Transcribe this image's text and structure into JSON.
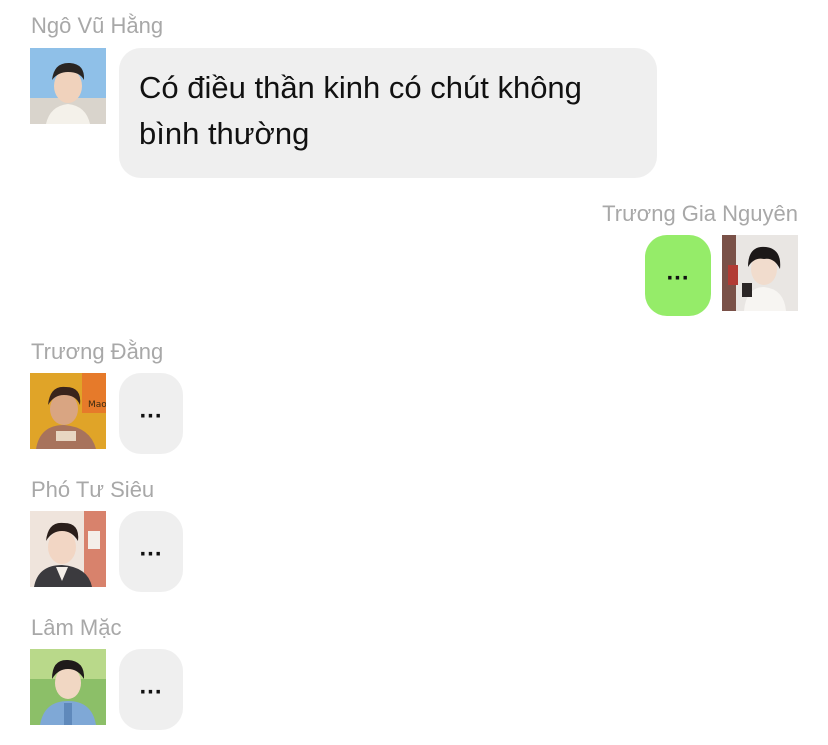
{
  "messages": [
    {
      "sender": "Ngô Vũ Hằng",
      "text": "Có điều thần kinh có chút không bình thường",
      "side": "left",
      "avatar": "avatar-ngo-vu-hang"
    },
    {
      "sender": "Trương Gia Nguyên",
      "text": "...",
      "side": "right",
      "avatar": "avatar-truong-gia-nguyen"
    },
    {
      "sender": "Trương Đằng",
      "text": "...",
      "side": "left",
      "avatar": "avatar-truong-dang"
    },
    {
      "sender": "Phó Tư Siêu",
      "text": "...",
      "side": "left",
      "avatar": "avatar-pho-tu-sieu"
    },
    {
      "sender": "Lâm Mặc",
      "text": "...",
      "side": "left",
      "avatar": "avatar-lam-mac"
    }
  ],
  "colors": {
    "background": "#ffffff",
    "bubble_other": "#efefef",
    "bubble_self": "#95ec69",
    "sender_name": "#a8a8a8",
    "message_text": "#111111"
  }
}
